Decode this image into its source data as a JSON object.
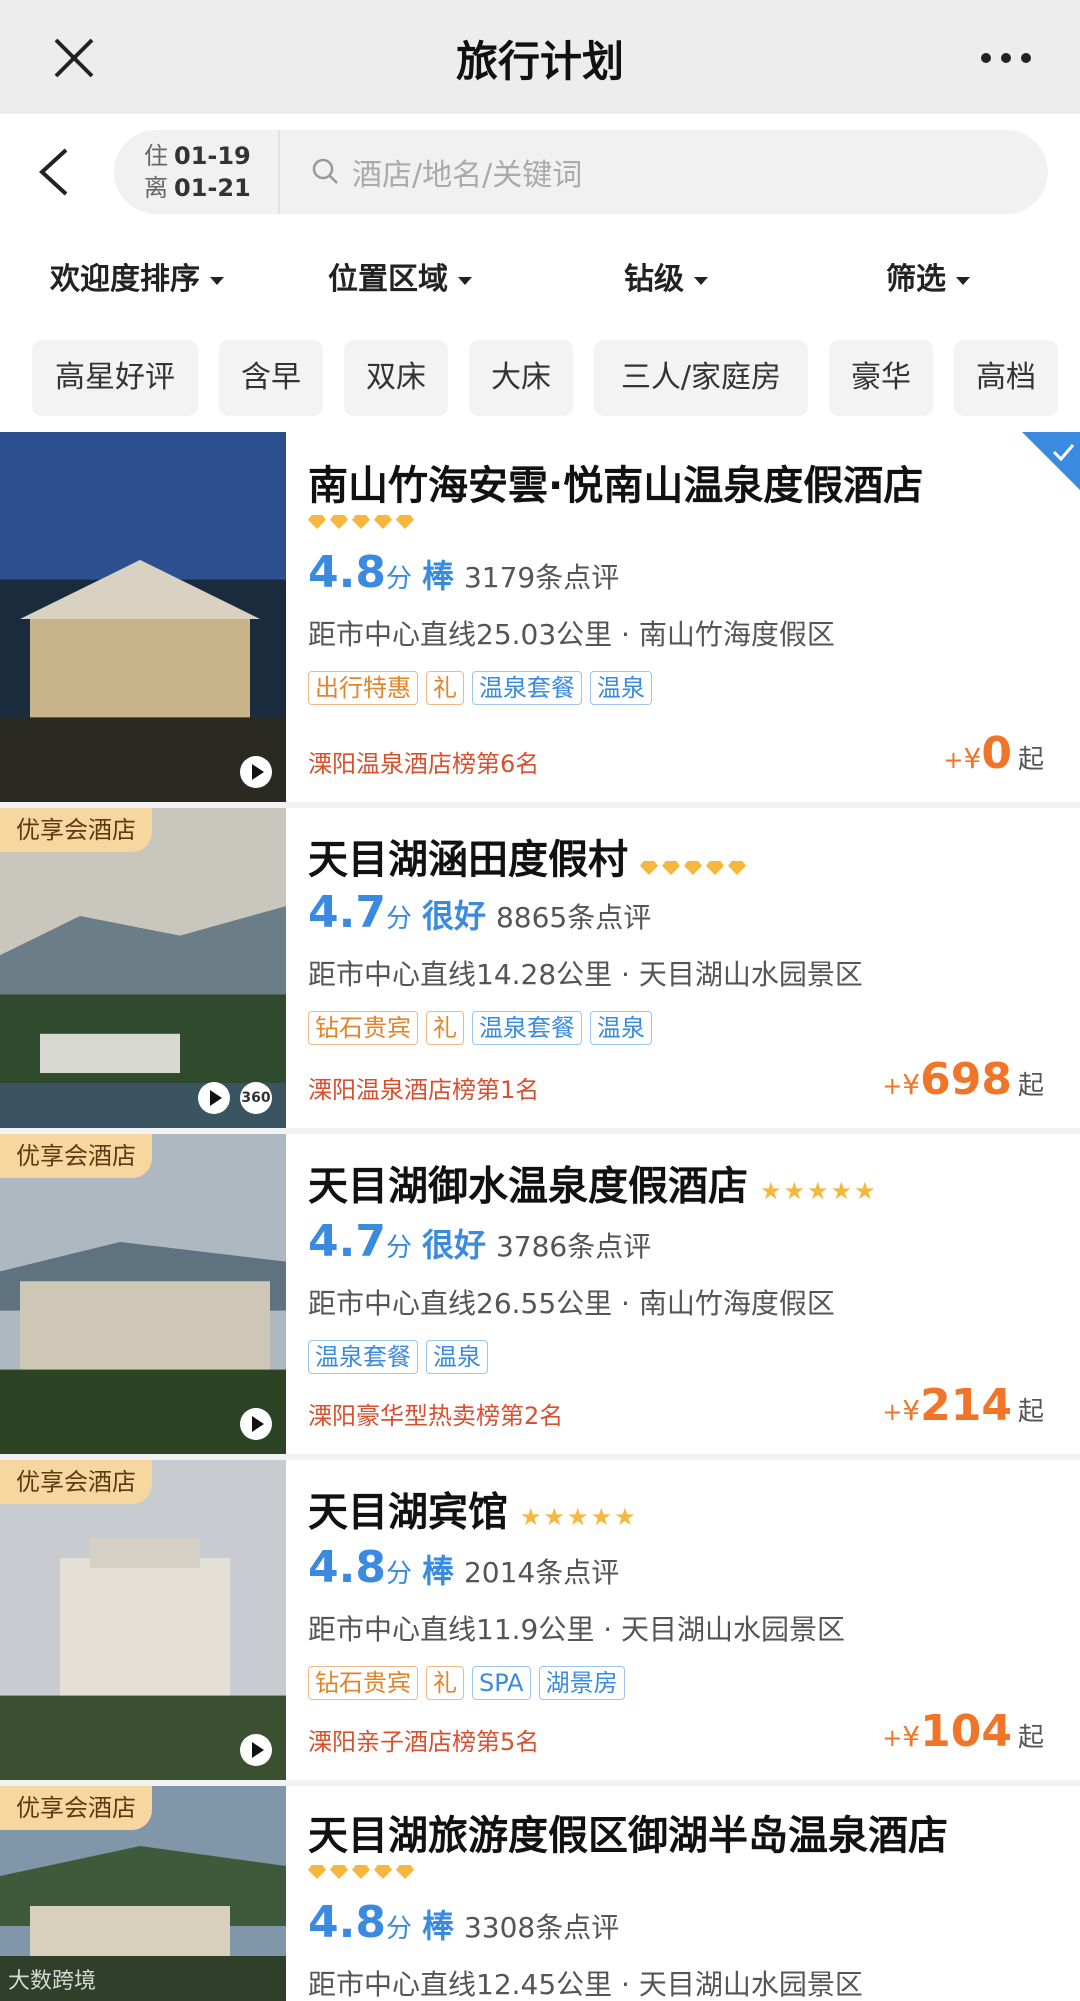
{
  "topbar": {
    "title": "旅行计划"
  },
  "search": {
    "checkin_label": "住",
    "checkin": "01-19",
    "checkout_label": "离",
    "checkout": "01-21",
    "placeholder": "酒店/地名/关键词"
  },
  "sort": [
    "欢迎度排序",
    "位置区域",
    "钻级",
    "筛选"
  ],
  "chips": [
    "高星好评",
    "含早",
    "双床",
    "大床",
    "三人/家庭房",
    "豪华",
    "高档"
  ],
  "hotels": [
    {
      "name": "南山竹海安雲·悦南山温泉度假酒店",
      "rating_icon": "diamond",
      "rating_count": 5,
      "score": "4.8",
      "unit": "分",
      "grade": "棒",
      "reviews": "3179条点评",
      "distance": "距市中心直线25.03公里 · 南山竹海度假区",
      "tags": [
        {
          "t": "出行特惠",
          "c": "orange"
        },
        {
          "t": "礼",
          "c": "orange"
        },
        {
          "t": "温泉套餐",
          "c": "blue"
        },
        {
          "t": "温泉",
          "c": "blue"
        }
      ],
      "rank": "溧阳温泉酒店榜第6名",
      "price_prefix": "+",
      "currency": "¥",
      "price": "0",
      "price_suffix": "起",
      "vip_badge": "",
      "selected": true
    },
    {
      "name": "天目湖涵田度假村",
      "rating_icon": "diamond",
      "rating_count": 5,
      "score": "4.7",
      "unit": "分",
      "grade": "很好",
      "reviews": "8865条点评",
      "distance": "距市中心直线14.28公里 · 天目湖山水园景区",
      "tags": [
        {
          "t": "钻石贵宾",
          "c": "orange"
        },
        {
          "t": "礼",
          "c": "orange"
        },
        {
          "t": "温泉套餐",
          "c": "blue"
        },
        {
          "t": "温泉",
          "c": "blue"
        }
      ],
      "rank": "溧阳温泉酒店榜第1名",
      "price_prefix": "+",
      "currency": "¥",
      "price": "698",
      "price_suffix": "起",
      "vip_badge": "优享会酒店",
      "three_sixty": "360"
    },
    {
      "name": "天目湖御水温泉度假酒店",
      "rating_icon": "star",
      "rating_count": 5,
      "score": "4.7",
      "unit": "分",
      "grade": "很好",
      "reviews": "3786条点评",
      "distance": "距市中心直线26.55公里 · 南山竹海度假区",
      "tags": [
        {
          "t": "温泉套餐",
          "c": "blue"
        },
        {
          "t": "温泉",
          "c": "blue"
        }
      ],
      "rank": "溧阳豪华型热卖榜第2名",
      "price_prefix": "+",
      "currency": "¥",
      "price": "214",
      "price_suffix": "起",
      "vip_badge": "优享会酒店"
    },
    {
      "name": "天目湖宾馆",
      "rating_icon": "star",
      "rating_count": 5,
      "score": "4.8",
      "unit": "分",
      "grade": "棒",
      "reviews": "2014条点评",
      "distance": "距市中心直线11.9公里 · 天目湖山水园景区",
      "tags": [
        {
          "t": "钻石贵宾",
          "c": "orange"
        },
        {
          "t": "礼",
          "c": "orange"
        },
        {
          "t": "SPA",
          "c": "blue"
        },
        {
          "t": "湖景房",
          "c": "blue"
        }
      ],
      "rank": "溧阳亲子酒店榜第5名",
      "price_prefix": "+",
      "currency": "¥",
      "price": "104",
      "price_suffix": "起",
      "vip_badge": "优享会酒店"
    },
    {
      "name": "天目湖旅游度假区御湖半岛温泉酒店",
      "rating_icon": "diamond",
      "rating_count": 5,
      "score": "4.8",
      "unit": "分",
      "grade": "棒",
      "reviews": "3308条点评",
      "distance": "距市中心直线12.45公里 · 天目湖山水园景区",
      "tags": [],
      "rank": "",
      "vip_badge": "优享会酒店"
    }
  ],
  "watermark": "大数跨境",
  "colors": {
    "accent_blue": "#3a8be0",
    "price_orange": "#f07528",
    "rank_red": "#d9502e",
    "vip_gold": "#f7d7a0"
  }
}
